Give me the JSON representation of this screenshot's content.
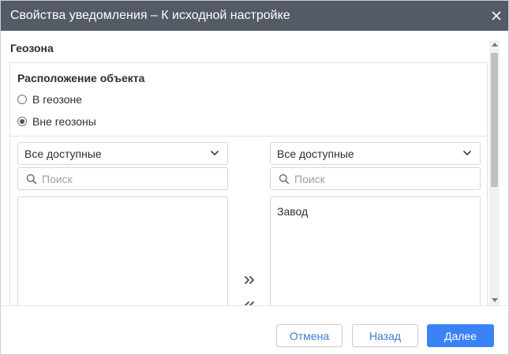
{
  "dialog": {
    "title": "Свойства уведомления – К исходной настройке"
  },
  "section": {
    "title": "Геозона"
  },
  "location": {
    "title": "Расположение объекта",
    "options": [
      {
        "label": "В геозоне",
        "checked": false
      },
      {
        "label": "Вне геозоны",
        "checked": true
      }
    ]
  },
  "left_panel": {
    "filter_value": "Все доступные",
    "search_placeholder": "Поиск",
    "items": []
  },
  "right_panel": {
    "filter_value": "Все доступные",
    "search_placeholder": "Поиск",
    "items": [
      "Завод"
    ]
  },
  "icons": {
    "close": "close-icon",
    "chevron": "chevron-down-icon",
    "search": "search-icon",
    "move_right": "double-chevron-right-icon",
    "move_left": "double-chevron-left-icon"
  },
  "footer": {
    "cancel_label": "Отмена",
    "back_label": "Назад",
    "next_label": "Далее"
  },
  "colors": {
    "titlebar": "#545b66",
    "accent": "#3b82f6",
    "link": "#3a7bd5"
  }
}
